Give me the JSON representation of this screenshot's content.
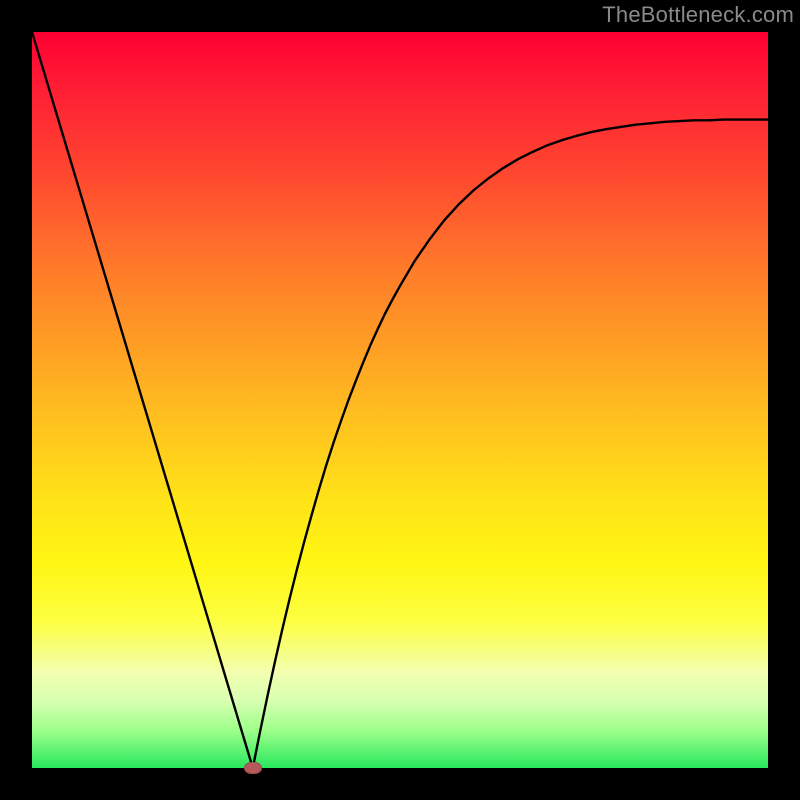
{
  "watermark": "TheBottleneck.com",
  "colors": {
    "frame": "#000000",
    "watermark": "#8a8a8a",
    "curve": "#000000",
    "marker": "#b55a5a",
    "gradient_top": "#ff0033",
    "gradient_bottom": "#28e85e"
  },
  "chart_data": {
    "type": "line",
    "title": "",
    "xlabel": "",
    "ylabel": "",
    "xlim": [
      0,
      100
    ],
    "ylim": [
      0,
      100
    ],
    "grid": false,
    "x": [
      0,
      1,
      2,
      3,
      4,
      5,
      6,
      7,
      8,
      9,
      10,
      11,
      12,
      13,
      14,
      15,
      16,
      17,
      18,
      19,
      20,
      21,
      22,
      23,
      24,
      25,
      26,
      27,
      28,
      29,
      30,
      31,
      32,
      33,
      34,
      35,
      36,
      37,
      38,
      39,
      40,
      41,
      42,
      43,
      44,
      45,
      46,
      47,
      48,
      49,
      50,
      52,
      54,
      56,
      58,
      60,
      62,
      64,
      66,
      68,
      70,
      72,
      74,
      76,
      78,
      80,
      82,
      84,
      86,
      88,
      90,
      92,
      94,
      96,
      98,
      100
    ],
    "values": [
      100,
      96.67,
      93.33,
      90,
      86.67,
      83.33,
      80,
      76.67,
      73.33,
      70,
      66.67,
      63.33,
      60,
      56.67,
      53.33,
      50,
      46.67,
      43.33,
      40,
      36.67,
      33.33,
      30,
      26.67,
      23.33,
      20,
      16.67,
      13.33,
      10,
      6.67,
      3.33,
      0,
      5,
      9.8,
      14.4,
      18.8,
      23,
      27,
      30.8,
      34.4,
      37.9,
      41.2,
      44.3,
      47.2,
      50,
      52.6,
      55.1,
      57.5,
      59.7,
      61.8,
      63.7,
      65.5,
      68.9,
      71.8,
      74.4,
      76.6,
      78.5,
      80.1,
      81.5,
      82.7,
      83.7,
      84.6,
      85.3,
      85.9,
      86.4,
      86.8,
      87.1,
      87.4,
      87.6,
      87.8,
      87.9,
      88,
      88,
      88.1,
      88.1,
      88.1,
      88.1
    ],
    "minimum": {
      "x": 30,
      "y": 0
    },
    "legend": false
  }
}
